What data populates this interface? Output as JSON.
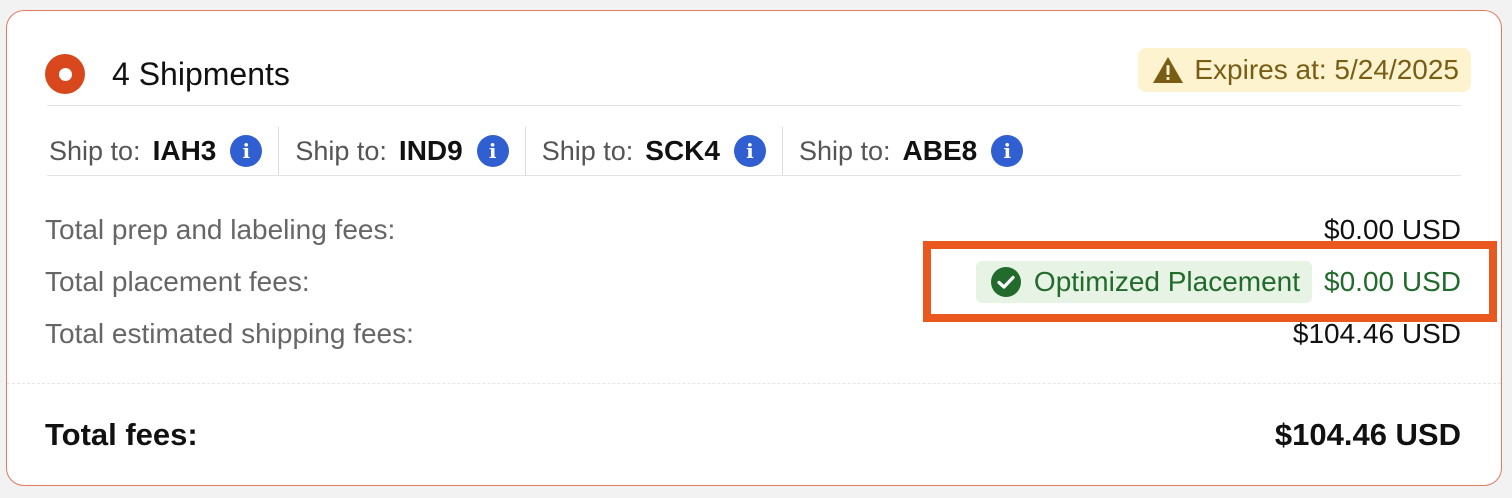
{
  "header": {
    "title": "4 Shipments",
    "expires_label": "Expires at: 5/24/2025"
  },
  "shipments": [
    {
      "prefix": "Ship to:",
      "code": "IAH3",
      "info": "i"
    },
    {
      "prefix": "Ship to:",
      "code": "IND9",
      "info": "i"
    },
    {
      "prefix": "Ship to:",
      "code": "SCK4",
      "info": "i"
    },
    {
      "prefix": "Ship to:",
      "code": "ABE8",
      "info": "i"
    }
  ],
  "fees": {
    "prep_label": "Total prep and labeling fees:",
    "prep_value": "$0.00 USD",
    "placement_label": "Total placement fees:",
    "placement_badge": "Optimized Placement",
    "placement_value": "$0.00 USD",
    "shipping_label": "Total estimated shipping fees:",
    "shipping_value": "$104.46 USD",
    "total_label": "Total fees:",
    "total_value": "$104.46 USD"
  },
  "colors": {
    "accent": "#d9481c",
    "card_border": "#e07a5f",
    "warning_bg": "#fdf3cf",
    "warning_text": "#7a5d14",
    "info": "#2f5fd0",
    "success_bg": "#e7f3e5",
    "success_text": "#226b2c",
    "highlight": "#e8581f"
  },
  "icons": {
    "selected": "radio-selected-icon",
    "warning": "warning-triangle-icon",
    "info": "info-icon",
    "success": "check-circle-icon"
  }
}
